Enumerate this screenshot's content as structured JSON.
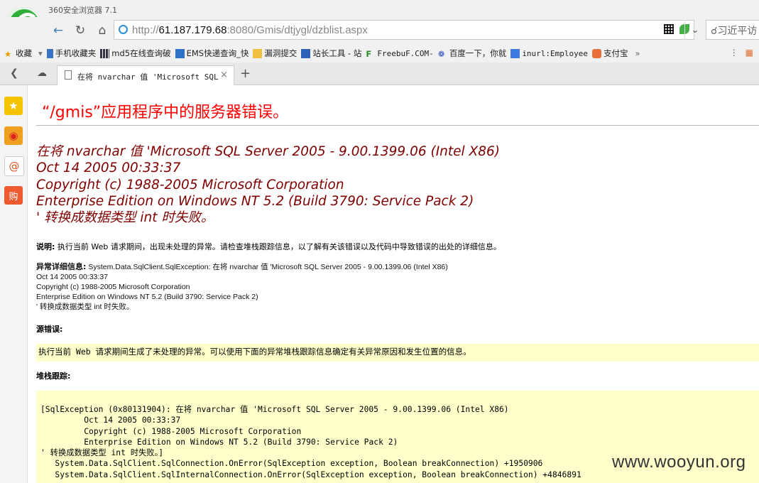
{
  "app": {
    "title": "360安全浏览器 7.1"
  },
  "address_bar": {
    "url_host": "61.187.179.68",
    "url_rest": ":8080/Gmis/dtjygl/dzblist.aspx",
    "url_prefix": "http://",
    "search_text": "习近平访"
  },
  "bookmarks": [
    {
      "label": "收藏",
      "icon": "star-icon"
    },
    {
      "label": "手机收藏夹",
      "icon": "phone-icon"
    },
    {
      "label": "md5在线查询破",
      "icon": "grid-icon"
    },
    {
      "label": "EMS快递查询_快",
      "icon": "ems-icon"
    },
    {
      "label": "漏洞提交",
      "icon": "folder-icon"
    },
    {
      "label": "站长工具 - 站",
      "icon": "tool-icon"
    },
    {
      "label": "FreebuF.COM-",
      "icon": "freebuf-icon"
    },
    {
      "label": "百度一下，你就",
      "icon": "baidu-icon"
    },
    {
      "label": "inurl:Employee",
      "icon": "google-icon"
    },
    {
      "label": "支付宝",
      "icon": "alipay-icon"
    }
  ],
  "tab": {
    "title": "在将 nvarchar 值 'Microsoft SQL Se",
    "close": "×",
    "new": "+"
  },
  "page": {
    "title": "“/gmis”应用程序中的服务器错误。",
    "error_lines": [
      "在将 nvarchar 值 'Microsoft SQL Server 2005 - 9.00.1399.06 (Intel X86)",
      "Oct 14 2005 00:33:37",
      "Copyright (c) 1988-2005 Microsoft Corporation",
      "Enterprise Edition on Windows NT 5.2 (Build 3790: Service Pack 2)",
      "' 转换成数据类型 int 时失败。"
    ],
    "description_label": "说明:",
    "description_text": " 执行当前 Web 请求期间，出现未处理的异常。请检查堆栈跟踪信息，以了解有关该错误以及代码中导致错误的出处的详细信息。",
    "exception_label": "异常详细信息:",
    "exception_lines": [
      " System.Data.SqlClient.SqlException: 在将  nvarchar 值  'Microsoft SQL Server 2005 - 9.00.1399.06 (Intel X86)",
      "Oct 14 2005 00:33:37",
      "Copyright (c) 1988-2005 Microsoft Corporation",
      "Enterprise Edition on Windows NT 5.2 (Build 3790: Service Pack 2)",
      "' 转换成数据类型  int 时失败。"
    ],
    "source_label": "源错误:",
    "source_text": "执行当前 Web 请求期间生成了未处理的异常。可以使用下面的异常堆栈跟踪信息确定有关异常原因和发生位置的信息。",
    "stack_label": "堆栈跟踪:",
    "stack_lines": [
      "[SqlException (0x80131904): 在将 nvarchar 值 'Microsoft SQL Server 2005 - 9.00.1399.06 (Intel X86)",
      "         Oct 14 2005 00:33:37",
      "         Copyright (c) 1988-2005 Microsoft Corporation",
      "         Enterprise Edition on Windows NT 5.2 (Build 3790: Service Pack 2)",
      "' 转换成数据类型 int 时失败。]",
      "   System.Data.SqlClient.SqlConnection.OnError(SqlException exception, Boolean breakConnection) +1950906",
      "   System.Data.SqlClient.SqlInternalConnection.OnError(SqlException exception, Boolean breakConnection) +4846891"
    ]
  },
  "watermark": "www.wooyun.org"
}
